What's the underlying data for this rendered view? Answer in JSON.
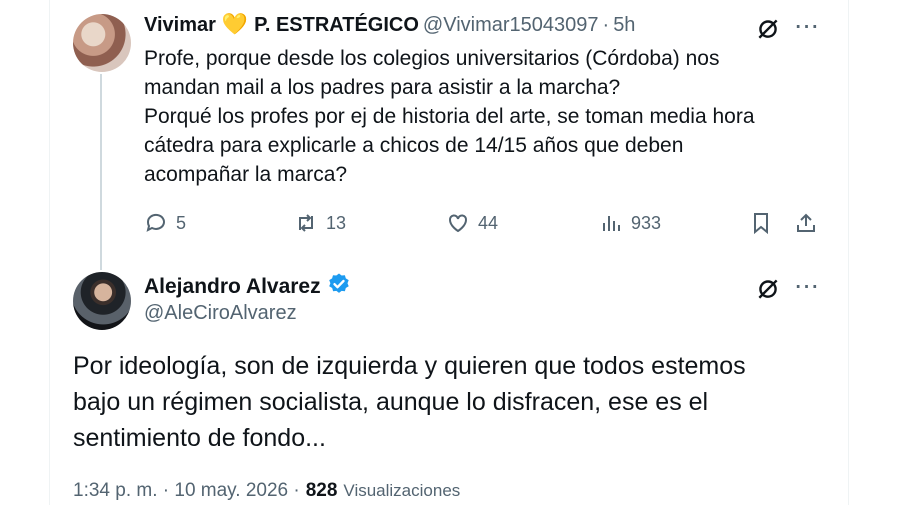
{
  "reply_tweet": {
    "author_name": "Vivimar",
    "author_emoji": "💛",
    "author_suffix": "P. ESTRATÉGICO",
    "handle": "@Vivimar15043097",
    "separator": "·",
    "time_ago": "5h",
    "text_lines": [
      "Profe, porque desde los colegios universitarios (Córdoba) nos",
      "mandan mail a los padres para asistir a la marcha?",
      "Porqué los profes por ej de historia del arte, se toman media hora",
      "cátedra para explicarle a chicos de 14/15 años que deben",
      "acompañar la marca?"
    ],
    "stats": {
      "replies": "5",
      "reposts": "13",
      "likes": "44",
      "views": "933"
    },
    "icons": [
      "grok-icon",
      "more-icon",
      "reply-icon",
      "repost-icon",
      "like-icon",
      "views-icon",
      "bookmark-icon",
      "share-icon"
    ]
  },
  "main_tweet": {
    "author_name": "Alejandro Alvarez",
    "handle": "@AleCiroAlvarez",
    "text_lines": [
      "Por ideología, son de izquierda y quieren que todos estemos",
      "bajo un régimen socialista, aunque lo disfracen, ese es el",
      "sentimiento de fondo..."
    ],
    "timestamp": "1:34 p. m. · 10 may. 2026 ·",
    "views_count": "828",
    "views_label": "Visualizaciones",
    "icons": [
      "verified-badge-icon",
      "grok-icon",
      "more-icon"
    ]
  },
  "colors": {
    "text": "#0f1419",
    "muted": "#536471",
    "verified": "#1d9bf0",
    "thread_line": "#cfd9de",
    "border": "#eff3f4"
  }
}
